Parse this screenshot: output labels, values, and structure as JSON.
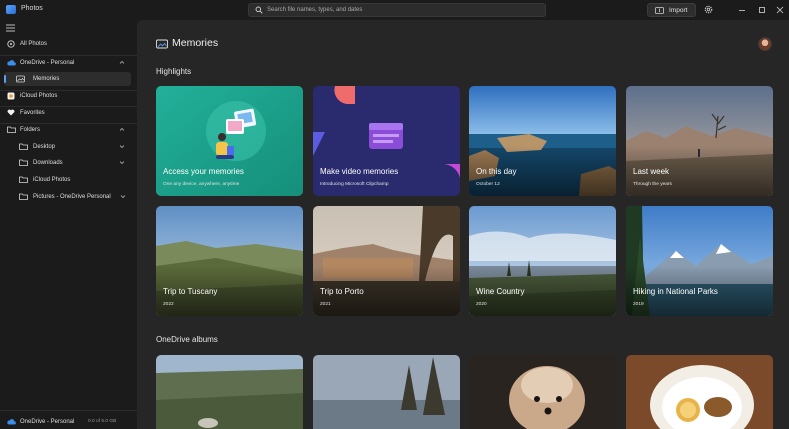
{
  "window": {
    "title": "Photos"
  },
  "search": {
    "placeholder": "Search file names, types, and dates"
  },
  "toolbar": {
    "import_label": "Import"
  },
  "sidebar": {
    "items": [
      {
        "label": "All Photos",
        "icon": "all-photos-icon"
      },
      {
        "label": "OneDrive - Personal",
        "icon": "onedrive-cloud-icon"
      },
      {
        "label": "Memories",
        "icon": "memories-icon",
        "selected": true
      },
      {
        "label": "iCloud Photos",
        "icon": "icloud-icon"
      },
      {
        "label": "Favorites",
        "icon": "heart-icon"
      },
      {
        "label": "Folders",
        "icon": "folder-icon"
      },
      {
        "label": "Desktop",
        "icon": "folder-icon"
      },
      {
        "label": "Downloads",
        "icon": "folder-icon"
      },
      {
        "label": "iCloud Photos",
        "icon": "folder-icon"
      },
      {
        "label": "Pictures - OneDrive Personal",
        "icon": "folder-icon"
      }
    ],
    "footer": {
      "label": "OneDrive - Personal",
      "storage": "0.0 of 5.0 GB"
    }
  },
  "page": {
    "title": "Memories",
    "highlights_heading": "Highlights",
    "albums_heading": "OneDrive albums"
  },
  "highlights": [
    {
      "title": "Access your memories",
      "subtitle": "One any device, anywhere, anytime"
    },
    {
      "title": "Make video memories",
      "subtitle": "Introducing Microsoft Clipchamp"
    },
    {
      "title": "On this day",
      "subtitle": "October 12"
    },
    {
      "title": "Last week",
      "subtitle": "Through the years"
    },
    {
      "title": "Trip to Tuscany",
      "subtitle": "2022"
    },
    {
      "title": "Trip to Porto",
      "subtitle": "2021"
    },
    {
      "title": "Wine Country",
      "subtitle": "2020"
    },
    {
      "title": "Hiking in National Parks",
      "subtitle": "2019"
    }
  ],
  "colors": {
    "accent": "#5aa0f2",
    "sidebar_bg": "#1b1b1b",
    "content_bg": "#262626",
    "teal_card": "#1fa88e",
    "navy_card": "#2a2a6e"
  }
}
